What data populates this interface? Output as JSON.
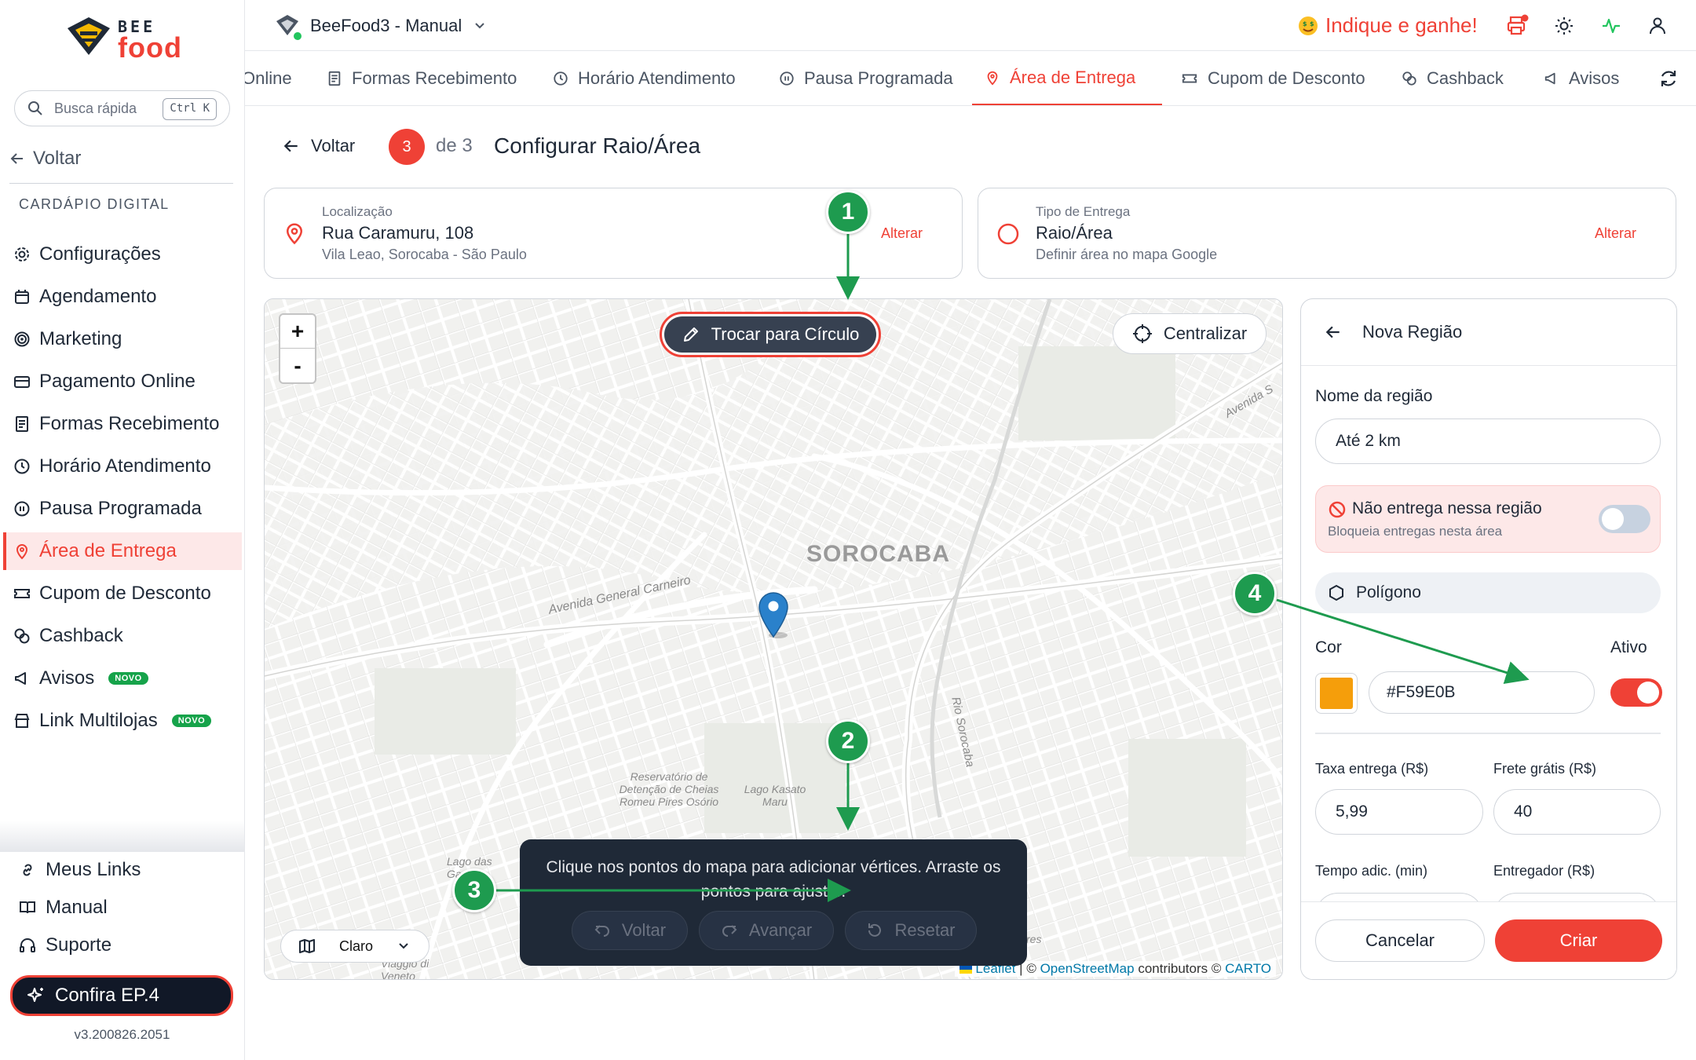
{
  "sidebar": {
    "logo_top": "BEE",
    "logo_bottom": "food",
    "search_placeholder": "Busca rápida",
    "search_shortcut": "Ctrl K",
    "back_label": "Voltar",
    "section_title": "CARDÁPIO DIGITAL",
    "items": [
      {
        "label": "Configurações",
        "icon": "gear-icon"
      },
      {
        "label": "Agendamento",
        "icon": "calendar-icon"
      },
      {
        "label": "Marketing",
        "icon": "target-icon"
      },
      {
        "label": "Pagamento Online",
        "icon": "credit-card-icon"
      },
      {
        "label": "Formas Recebimento",
        "icon": "receipt-icon"
      },
      {
        "label": "Horário Atendimento",
        "icon": "clock-icon"
      },
      {
        "label": "Pausa Programada",
        "icon": "pause-icon"
      },
      {
        "label": "Área de Entrega",
        "icon": "map-pin-icon",
        "active": true
      },
      {
        "label": "Cupom de Desconto",
        "icon": "ticket-icon"
      },
      {
        "label": "Cashback",
        "icon": "coins-icon"
      },
      {
        "label": "Avisos",
        "icon": "megaphone-icon",
        "badge": "NOVO"
      },
      {
        "label": "Link Multilojas",
        "icon": "store-icon",
        "badge": "NOVO"
      }
    ],
    "footer_links": [
      {
        "label": "Meus Links",
        "icon": "link-icon"
      },
      {
        "label": "Manual",
        "icon": "book-icon"
      },
      {
        "label": "Suporte",
        "icon": "headset-icon"
      }
    ],
    "promo_label": "Confira EP.4",
    "version": "v3.200826.2051"
  },
  "header": {
    "store_name": "BeeFood3 - Manual",
    "indique": "Indique e ganhe!"
  },
  "tabs": [
    {
      "label": "Online",
      "icon": ""
    },
    {
      "label": "Formas Recebimento",
      "icon": "receipt-icon"
    },
    {
      "label": "Horário Atendimento",
      "icon": "clock-icon"
    },
    {
      "label": "Pausa Programada",
      "icon": "pause-icon"
    },
    {
      "label": "Área de Entrega",
      "icon": "map-pin-icon",
      "active": true
    },
    {
      "label": "Cupom de Desconto",
      "icon": "ticket-icon"
    },
    {
      "label": "Cashback",
      "icon": "coins-icon"
    },
    {
      "label": "Avisos",
      "icon": "megaphone-icon"
    }
  ],
  "step": {
    "back_label": "Voltar",
    "current": "3",
    "of_label": "de 3",
    "title": "Configurar Raio/Área"
  },
  "location_card": {
    "label": "Localização",
    "value": "Rua Caramuru, 108",
    "sub": "Vila Leao, Sorocaba - São Paulo",
    "action": "Alterar"
  },
  "delivery_card": {
    "label": "Tipo de Entrega",
    "value": "Raio/Área",
    "sub": "Definir área no mapa Google",
    "action": "Alterar"
  },
  "map": {
    "zoom_in": "+",
    "zoom_out": "-",
    "swap_button": "Trocar para Círculo",
    "center_button": "Centralizar",
    "city_label": "SOROCABA",
    "street_1": "Avenida General Carneiro",
    "street_2": "Rio Sorocaba",
    "street_3": "Avenida S",
    "place_1": "Reservatório de Detenção de Cheias Romeu Pires Osório",
    "place_2": "Lago Kasato Maru",
    "place_3": "Lago das Garças",
    "place_4": "Viaggio di Veneto",
    "place_5": "res",
    "theme_select": "Claro",
    "attribution": {
      "leaflet": "Leaflet",
      "sep": " | © ",
      "osm": "OpenStreetMap",
      "contrib": " contributors © ",
      "carto": "CARTO"
    },
    "hint": "Clique nos pontos do mapa para adicionar vértices. Arraste os pontos para ajustar.",
    "hint_buttons": {
      "back": "Voltar",
      "forward": "Avançar",
      "reset": "Resetar"
    }
  },
  "panel": {
    "title": "Nova Região",
    "region_name_label": "Nome da região",
    "region_name_value": "Até 2 km",
    "no_delivery_title": "Não entrega nessa região",
    "no_delivery_sub": "Bloqueia entregas nesta área",
    "no_delivery_on": false,
    "shape": "Polígono",
    "color_label": "Cor",
    "active_label": "Ativo",
    "color_value": "#F59E0B",
    "active_on": true,
    "fee_label": "Taxa entrega (R$)",
    "fee_value": "5,99",
    "free_label": "Frete grátis (R$)",
    "free_value": "40",
    "time_label": "Tempo adic. (min)",
    "courier_label": "Entregador (R$)",
    "cancel": "Cancelar",
    "create": "Criar"
  },
  "annotations": [
    "1",
    "2",
    "3",
    "4"
  ],
  "colors": {
    "accent": "#EF4136",
    "marker_green": "#1E9B4F",
    "region_color": "#F59E0B",
    "map_pin": "#2A81CB"
  }
}
